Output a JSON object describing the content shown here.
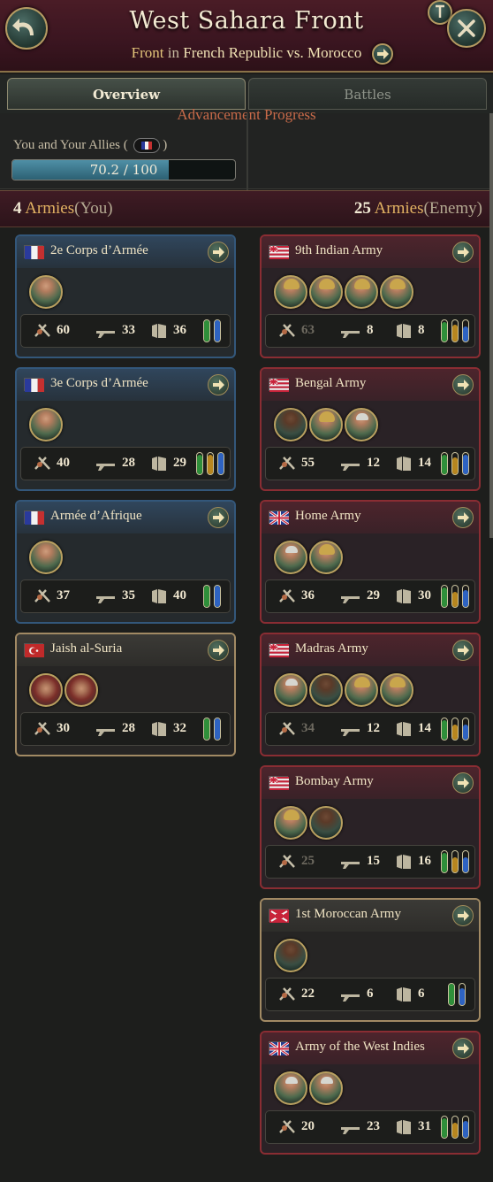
{
  "header": {
    "title": "West Sahara Front",
    "subtitle_prefix": "Front",
    "subtitle_in": "in",
    "subtitle_conflict": "French Republic vs. Morocco",
    "back_icon": "back-arrow-icon",
    "close_icon": "close-icon",
    "pin_icon": "pin-icon",
    "go_icon": "arrow-right-icon"
  },
  "tabs": [
    {
      "label": "Overview",
      "active": true
    },
    {
      "label": "Battles",
      "active": false
    }
  ],
  "advancement": {
    "title": "Advancement Progress",
    "allies_label": "You and Your Allies (",
    "allies_close": ")",
    "progress_text": "70.2 / 100",
    "progress_value": 70.2,
    "progress_max": 100
  },
  "counts": {
    "you": {
      "number": "4",
      "word": "Armies",
      "party": "(You)"
    },
    "enemy": {
      "number": "25",
      "word": "Armies",
      "party": "(Enemy)"
    }
  },
  "colors": {
    "organization_green": "#2f8f3a",
    "organization_amber": "#b7861f",
    "organization_blue": "#2e63c2"
  },
  "friendly_armies": [
    {
      "name": "2e Corps d’Armée",
      "flag": "france",
      "style": "blue",
      "generals": [
        "light"
      ],
      "infantry": "60",
      "artillery": "33",
      "supply": "36",
      "bars": [
        1,
        1
      ]
    },
    {
      "name": "3e Corps d’Armée",
      "flag": "france",
      "style": "blue",
      "generals": [
        "light"
      ],
      "infantry": "40",
      "artillery": "28",
      "supply": "29",
      "bars": [
        0.9,
        0.9,
        1
      ]
    },
    {
      "name": "Armée d’Afrique",
      "flag": "france",
      "style": "blue",
      "generals": [
        "light"
      ],
      "infantry": "37",
      "artillery": "35",
      "supply": "40",
      "bars": [
        1,
        1
      ]
    },
    {
      "name": "Jaish al-Suria",
      "flag": "ottoman",
      "style": "gold",
      "generals": [
        "fez",
        "fez"
      ],
      "infantry": "30",
      "artillery": "28",
      "supply": "32",
      "bars": [
        1,
        1
      ]
    }
  ],
  "enemy_armies": [
    {
      "name": "9th Indian Army",
      "flag": "company",
      "style": "red",
      "generals": [
        "helm",
        "helm",
        "helm",
        "helm"
      ],
      "infantry": "63",
      "infantry_dim": true,
      "artillery": "8",
      "supply": "8",
      "bars": [
        0.9,
        0.8,
        0.7
      ]
    },
    {
      "name": "Bengal Army",
      "flag": "company",
      "style": "red",
      "generals": [
        "dark",
        "helm",
        "grey"
      ],
      "infantry": "55",
      "artillery": "12",
      "supply": "14",
      "bars": [
        0.9,
        0.8,
        0.9
      ]
    },
    {
      "name": "Home Army",
      "flag": "uk",
      "style": "red",
      "generals": [
        "grey",
        "helm"
      ],
      "infantry": "36",
      "artillery": "29",
      "supply": "30",
      "bars": [
        0.9,
        0.7,
        0.8
      ]
    },
    {
      "name": "Madras Army",
      "flag": "company",
      "style": "red",
      "generals": [
        "grey",
        "dark",
        "helm",
        "helm"
      ],
      "infantry": "34",
      "infantry_dim": true,
      "artillery": "12",
      "supply": "14",
      "bars": [
        0.9,
        0.7,
        0.7
      ]
    },
    {
      "name": "Bombay Army",
      "flag": "company",
      "style": "red",
      "generals": [
        "helm",
        "dark"
      ],
      "infantry": "25",
      "infantry_dim": true,
      "artillery": "15",
      "supply": "16",
      "bars": [
        0.9,
        0.7,
        0.7
      ]
    },
    {
      "name": "1st Moroccan Army",
      "flag": "morocco",
      "style": "gold",
      "generals": [
        "dark"
      ],
      "infantry": "22",
      "artillery": "6",
      "supply": "6",
      "bars": [
        1,
        0.8
      ]
    },
    {
      "name": "Army of the West Indies",
      "flag": "uk",
      "style": "red",
      "generals": [
        "grey",
        "grey"
      ],
      "infantry": "20",
      "artillery": "23",
      "supply": "31",
      "bars": [
        0.9,
        0.7,
        0.8
      ]
    }
  ]
}
